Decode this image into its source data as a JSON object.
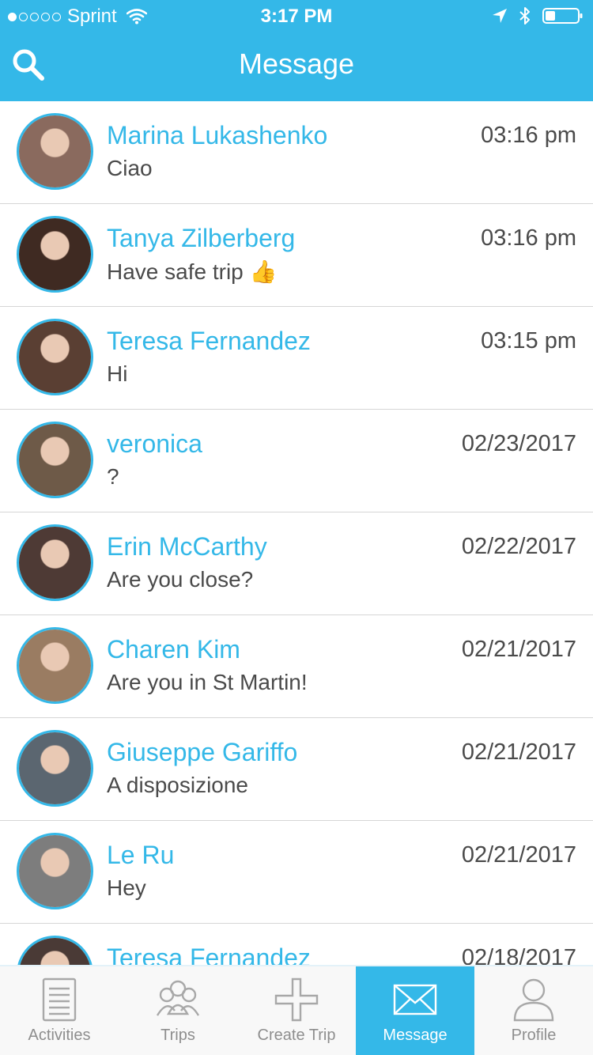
{
  "status_bar": {
    "carrier": "Sprint",
    "time": "3:17 PM"
  },
  "header": {
    "title": "Message"
  },
  "conversations": [
    {
      "name": "Marina Lukashenko",
      "preview": "Ciao",
      "time": "03:16 pm",
      "avatar_color": "#8a6a5e"
    },
    {
      "name": "Tanya Zilberberg",
      "preview": "Have safe trip 👍",
      "time": "03:16 pm",
      "avatar_color": "#3f2a22"
    },
    {
      "name": "Teresa Fernandez",
      "preview": "Hi",
      "time": "03:15 pm",
      "avatar_color": "#5a3f33"
    },
    {
      "name": "veronica",
      "preview": "?",
      "time": "02/23/2017",
      "avatar_color": "#6e5a48"
    },
    {
      "name": "Erin McCarthy",
      "preview": "Are you close?",
      "time": "02/22/2017",
      "avatar_color": "#4e3a35"
    },
    {
      "name": "Charen Kim",
      "preview": "Are you in St Martin!",
      "time": "02/21/2017",
      "avatar_color": "#9a7c62"
    },
    {
      "name": "Giuseppe Gariffo",
      "preview": "A disposizione",
      "time": "02/21/2017",
      "avatar_color": "#5b6670"
    },
    {
      "name": "Le Ru",
      "preview": "Hey",
      "time": "02/21/2017",
      "avatar_color": "#7d7d7d"
    },
    {
      "name": "Teresa Fernandez",
      "preview": "",
      "time": "02/18/2017",
      "avatar_color": "#4a3a36"
    }
  ],
  "tabs": [
    {
      "label": "Activities",
      "icon": "document-icon",
      "active": false
    },
    {
      "label": "Trips",
      "icon": "group-icon",
      "active": false
    },
    {
      "label": "Create Trip",
      "icon": "plus-icon",
      "active": false
    },
    {
      "label": "Message",
      "icon": "envelope-icon",
      "active": true
    },
    {
      "label": "Profile",
      "icon": "person-icon",
      "active": false
    }
  ],
  "colors": {
    "accent": "#34b8e8",
    "text": "#4a4a4a",
    "tab_inactive": "#8e8e8e"
  }
}
